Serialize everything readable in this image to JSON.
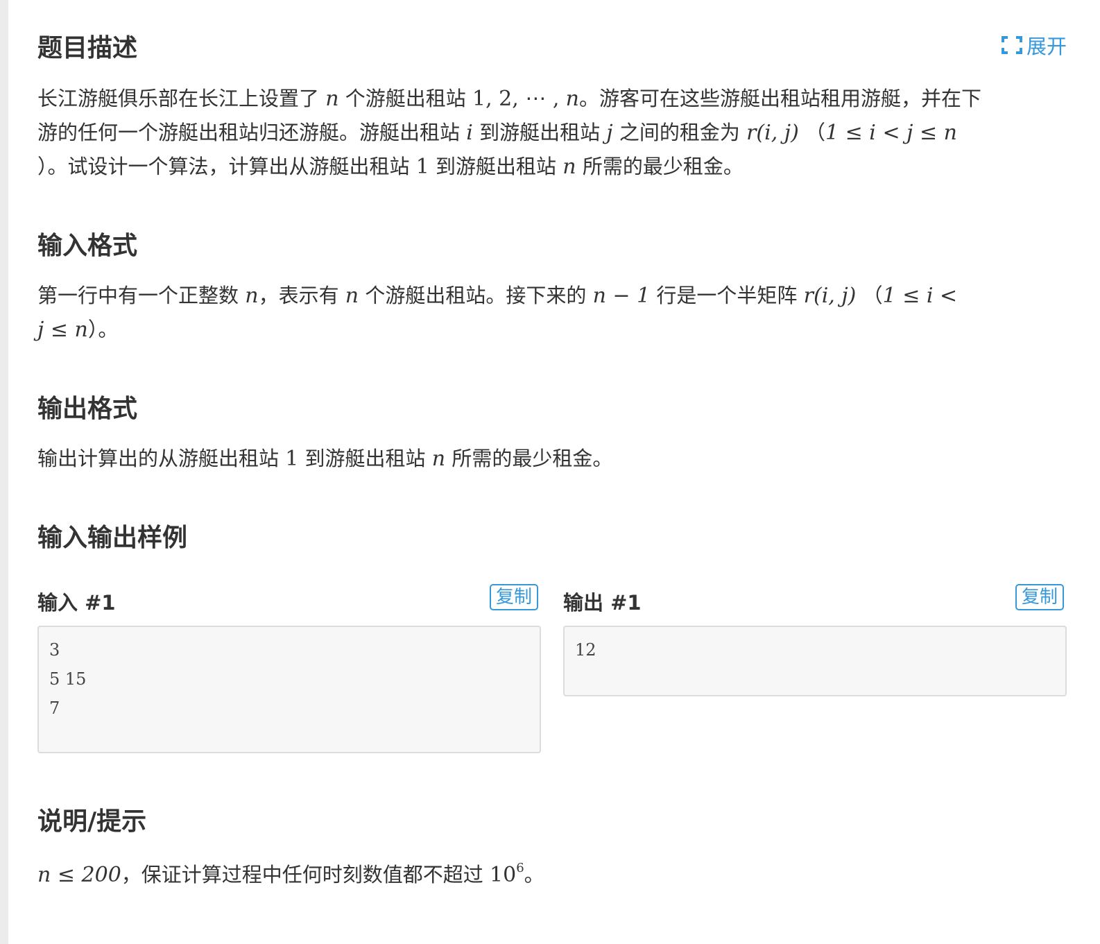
{
  "header": {
    "title": "题目描述",
    "expand_label": "展开",
    "expand_icon": "fullscreen-icon",
    "accent_color": "#3498db"
  },
  "description": {
    "l1_a": "长江游艇俱乐部在长江上设置了",
    "l1_n": "n",
    "l1_b": "个游艇出租站",
    "l1_seq_1": "1, 2, ⋯ ,",
    "l1_seq_n": "n",
    "l1_c": "。游客可在这些游艇出租站租用游艇，并在下",
    "l2_a": "游的任何一个游艇出租站归还游艇。游艇出租站",
    "l2_i": "i",
    "l2_b": "到游艇出租站",
    "l2_j": "j",
    "l2_c": "之间的租金为",
    "l2_r": "r(i, j)",
    "l2_d": "（",
    "l2_ineq": "1 ≤ i < j ≤ n",
    "l3_a": "）。试设计一个算法，计算出从游艇出租站",
    "l3_1": "1",
    "l3_b": "到游艇出租站",
    "l3_n": "n",
    "l3_c": "所需的最少租金。"
  },
  "input_format": {
    "title": "输入格式",
    "a": "第一行中有一个正整数",
    "n1": "n",
    "b": "，表示有",
    "n2": "n",
    "c": "个游艇出租站。接下来的",
    "nm1": "n − 1",
    "d": "行是一个半矩阵",
    "r": "r(i, j)",
    "e": "（",
    "ineq1": "1 ≤ i <",
    "ineq2": "j ≤ n",
    "f": "）。"
  },
  "output_format": {
    "title": "输出格式",
    "a": "输出计算出的从游艇出租站",
    "one": "1",
    "b": "到游艇出租站",
    "n": "n",
    "c": "所需的最少租金。"
  },
  "samples": {
    "title": "输入输出样例",
    "input_label": "输入 #1",
    "output_label": "输出 #1",
    "copy_label": "复制",
    "input_data": "3\n5 15\n7",
    "output_data": "12"
  },
  "hint": {
    "title": "说明/提示",
    "math1": "n ≤ 200",
    "text": "，保证计算过程中任何时刻数值都不超过",
    "base": "10",
    "exp": "6",
    "end": "。"
  }
}
